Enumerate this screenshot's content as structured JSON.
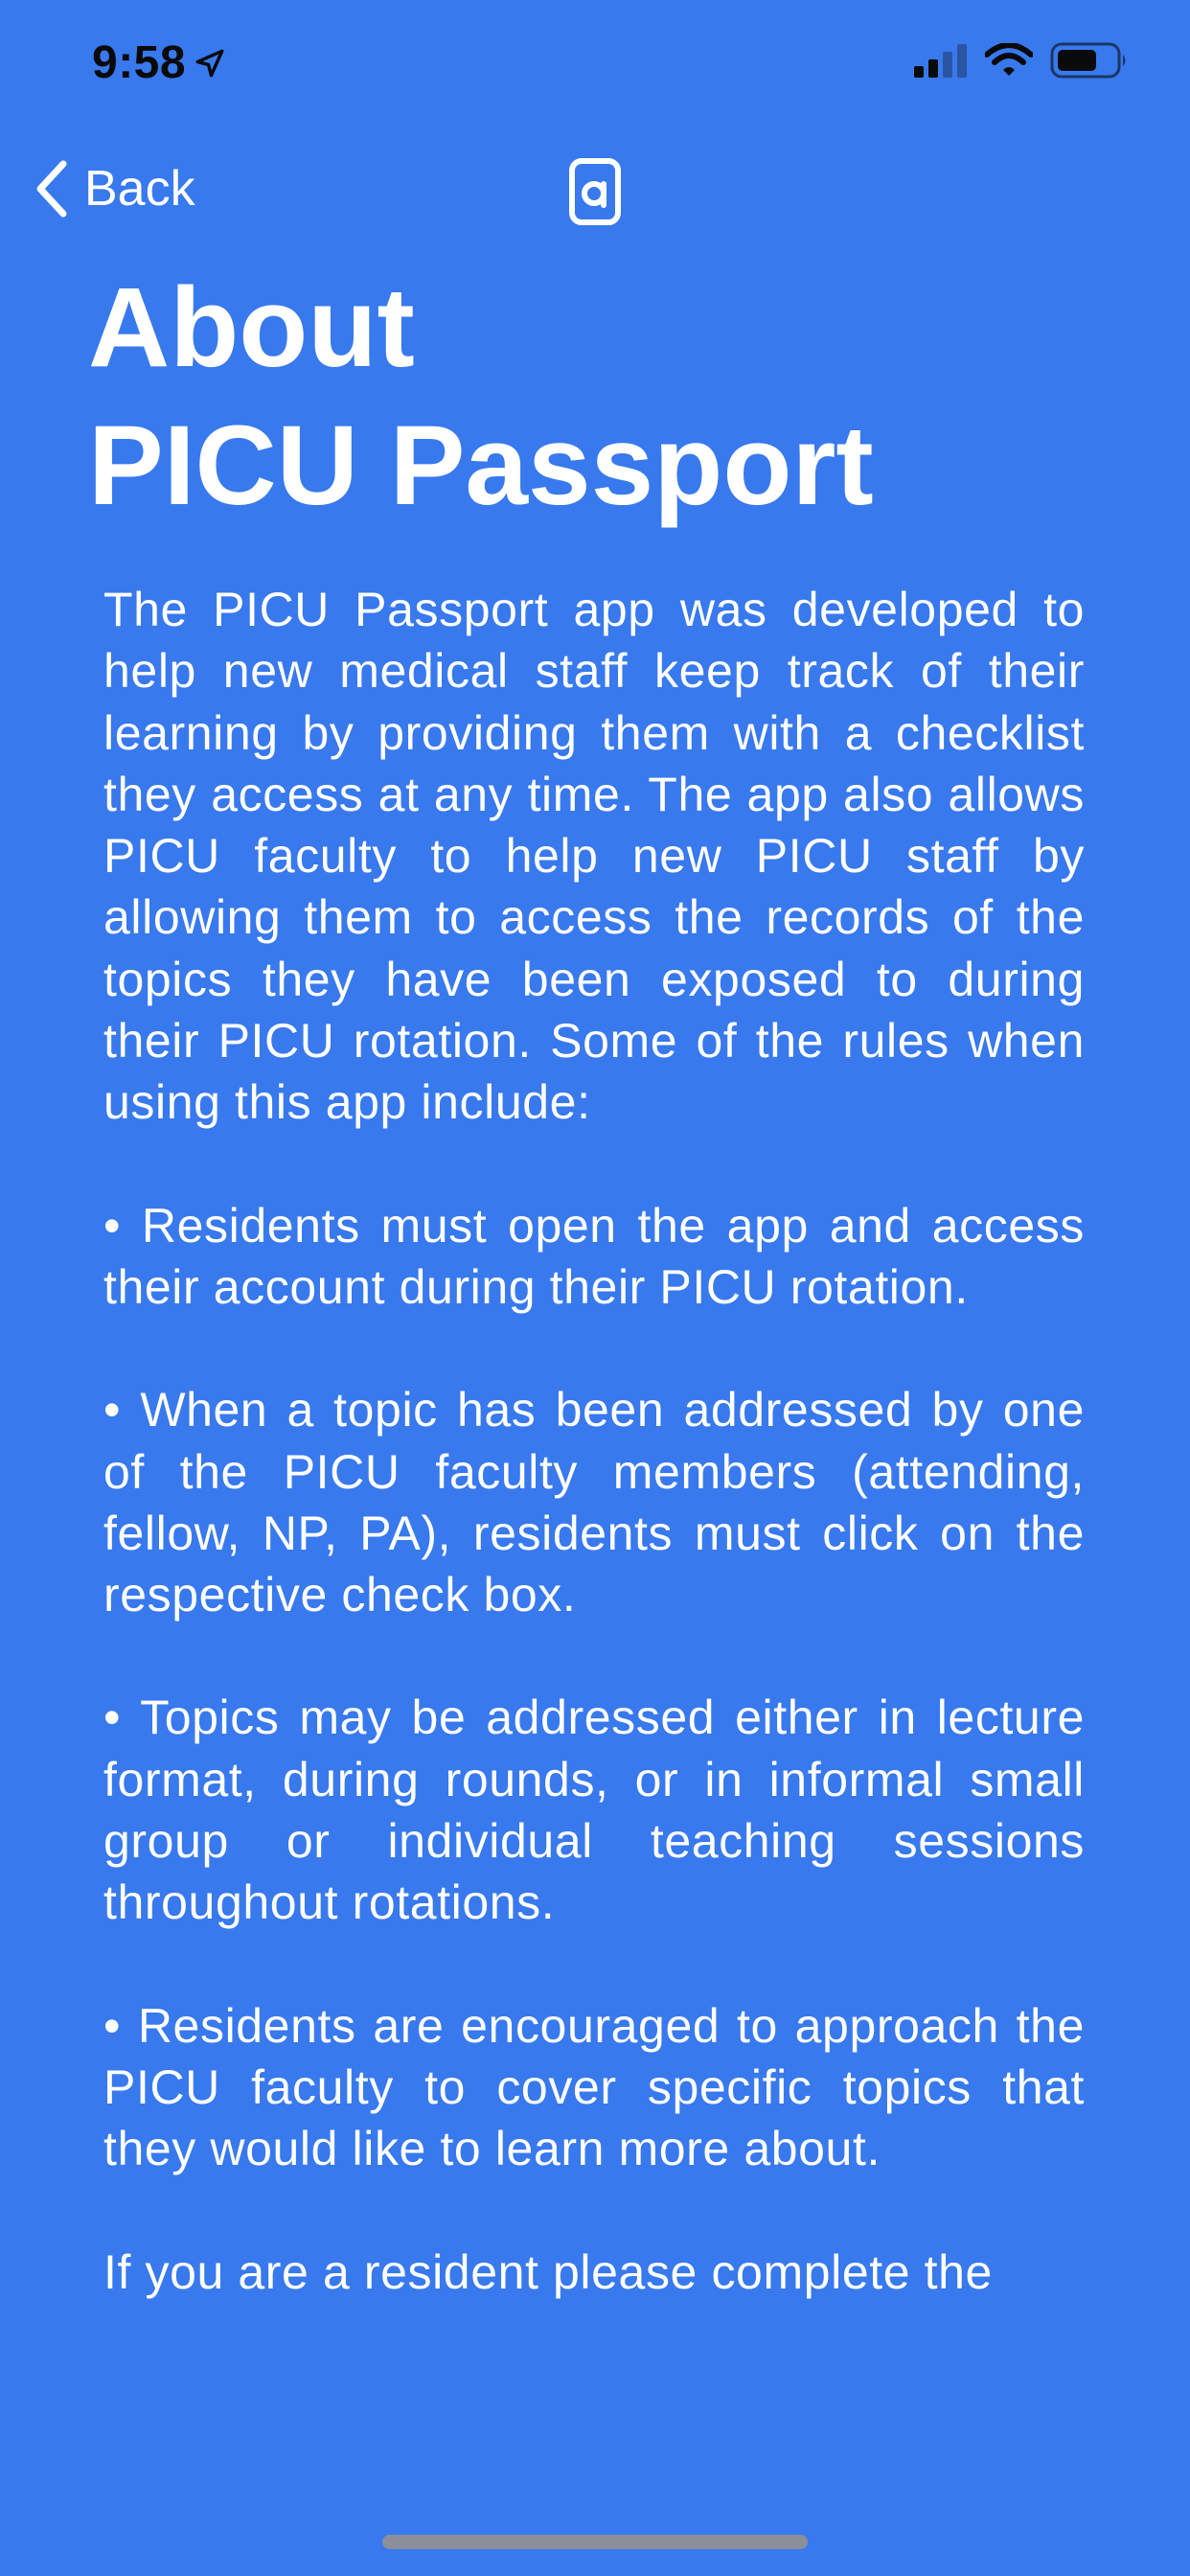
{
  "status_bar": {
    "time": "9:58",
    "icons": [
      "location-arrow-icon",
      "cellular-signal-icon",
      "wifi-icon",
      "battery-icon"
    ]
  },
  "nav": {
    "back_label": "Back",
    "logo_icon": "app-logo-icon"
  },
  "title": {
    "line1": "About",
    "line2": "PICU Passport"
  },
  "content": {
    "paragraphs": [
      "The PICU Passport app was developed to help new medical staff keep track of their learning by providing them with a checklist they access at any time. The app also allows PICU faculty to help new PICU staff by allowing them to access the records of the topics they have been exposed to during their PICU rotation. Some of the rules when using this app include:",
      "• Residents must open the app and access their account during their PICU rotation.",
      "• When a topic has been addressed by one of the PICU faculty members (attending, fellow, NP, PA), residents must click on the respective check box.",
      "• Topics may be addressed either in lecture format, during rounds, or in informal small group or individual teaching sessions throughout rotations.",
      "• Residents are encouraged to approach the PICU faculty to cover specific topics that they would like to learn more about.",
      "If you are a resident please complete the"
    ]
  },
  "colors": {
    "background": "#3879EE",
    "text": "#FFFFFF",
    "status_text": "#0A0A0A"
  }
}
